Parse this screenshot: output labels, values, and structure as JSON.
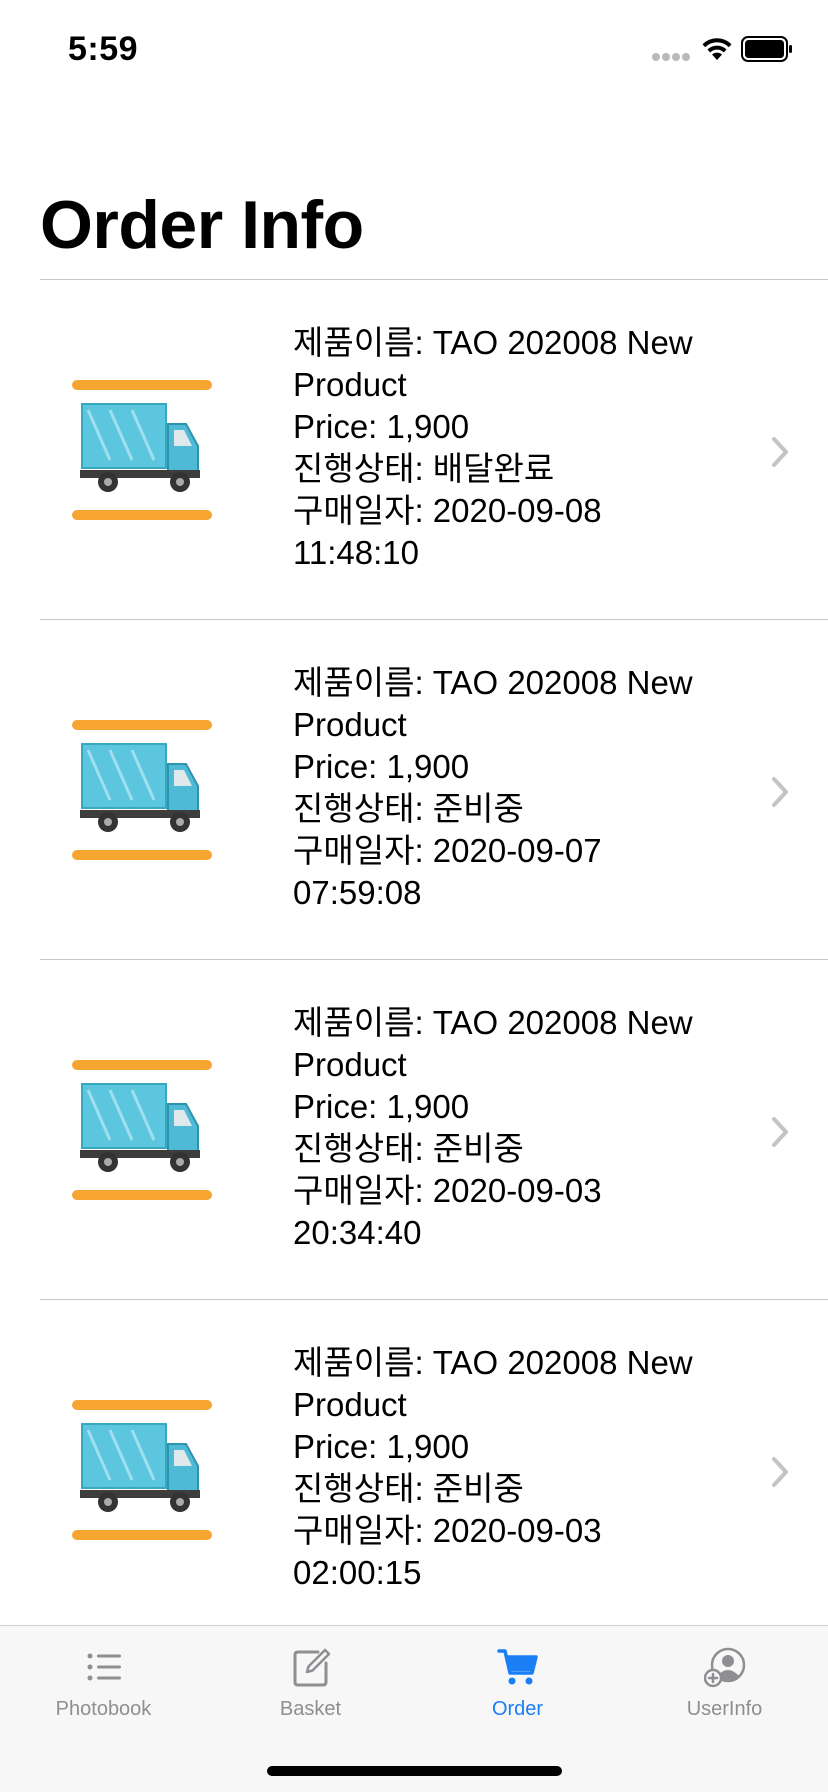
{
  "status_bar": {
    "time": "5:59"
  },
  "page": {
    "title": "Order Info"
  },
  "orders": [
    {
      "line1": "제품이름: TAO 202008 New Product",
      "line2": "Price: 1,900",
      "line3": "진행상태: 배달완료",
      "line4": "구매일자: 2020-09-08 11:48:10"
    },
    {
      "line1": "제품이름: TAO 202008 New Product",
      "line2": "Price: 1,900",
      "line3": "진행상태: 준비중",
      "line4": "구매일자: 2020-09-07 07:59:08"
    },
    {
      "line1": "제품이름: TAO 202008 New Product",
      "line2": "Price: 1,900",
      "line3": "진행상태: 준비중",
      "line4": "구매일자: 2020-09-03 20:34:40"
    },
    {
      "line1": "제품이름: TAO 202008 New Product",
      "line2": "Price: 1,900",
      "line3": "진행상태: 준비중",
      "line4": "구매일자: 2020-09-03 02:00:15"
    }
  ],
  "tab_bar": {
    "tabs": [
      {
        "label": "Photobook",
        "icon": "list-icon",
        "active": false
      },
      {
        "label": "Basket",
        "icon": "edit-icon",
        "active": false
      },
      {
        "label": "Order",
        "icon": "cart-icon",
        "active": true
      },
      {
        "label": "UserInfo",
        "icon": "add-user-icon",
        "active": false
      }
    ]
  },
  "colors": {
    "accent": "#1a7ef5",
    "inactive": "#8e8e93",
    "thumb_bar": "#f7a531",
    "truck_body": "#5bc6de"
  }
}
